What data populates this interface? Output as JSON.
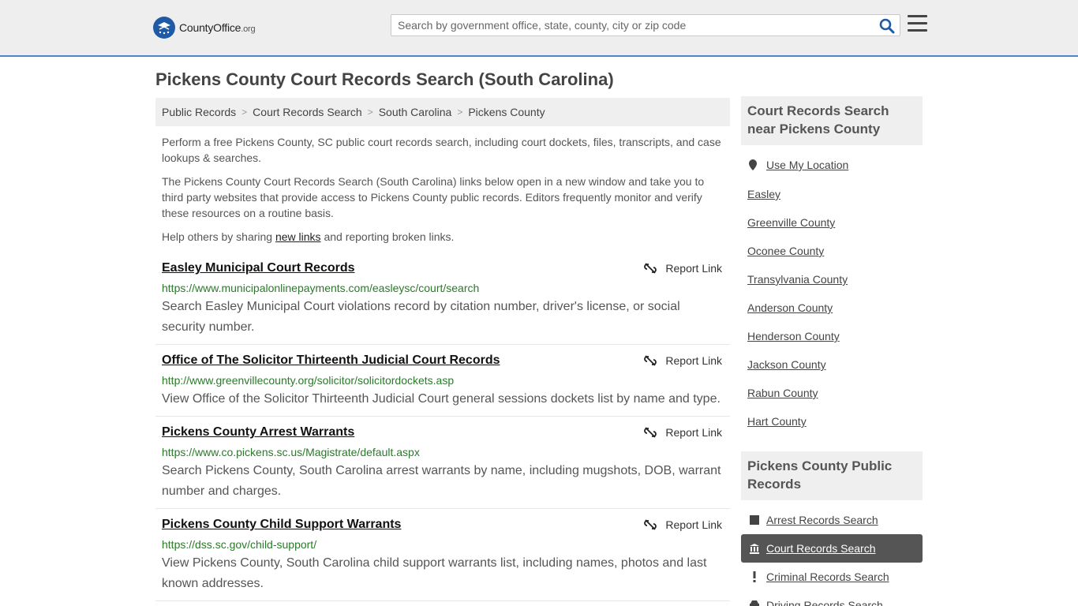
{
  "header": {
    "logo_main": "CountyOffice",
    "logo_org": ".org",
    "search_placeholder": "Search by government office, state, county, city or zip code"
  },
  "page": {
    "title": "Pickens County Court Records Search (South Carolina)"
  },
  "breadcrumb": [
    "Public Records",
    "Court Records Search",
    "South Carolina",
    "Pickens County"
  ],
  "intro": {
    "p1": "Perform a free Pickens County, SC public court records search, including court dockets, files, transcripts, and case lookups & searches.",
    "p2": "The Pickens County Court Records Search (South Carolina) links below open in a new window and take you to third party websites that provide access to Pickens County public records. Editors frequently monitor and verify these resources on a routine basis.",
    "p3_before": "Help others by sharing ",
    "p3_link": "new links",
    "p3_after": " and reporting broken links."
  },
  "report_label": "Report Link",
  "records": [
    {
      "title": "Easley Municipal Court Records",
      "url": "https://www.municipalonlinepayments.com/easleysc/court/search",
      "desc": "Search Easley Municipal Court violations record by citation number, driver's license, or social security number."
    },
    {
      "title": "Office of The Solicitor Thirteenth Judicial Court Records",
      "url": "http://www.greenvillecounty.org/solicitor/solicitordockets.asp",
      "desc": "View Office of the Solicitor Thirteenth Judicial Court general sessions dockets list by name and type."
    },
    {
      "title": "Pickens County Arrest Warrants",
      "url": "https://www.co.pickens.sc.us/Magistrate/default.aspx",
      "desc": "Search Pickens County, South Carolina arrest warrants by name, including mugshots, DOB, warrant number and charges."
    },
    {
      "title": "Pickens County Child Support Warrants",
      "url": "https://dss.sc.gov/child-support/",
      "desc": "View Pickens County, South Carolina child support warrants list, including names, photos and last known addresses."
    }
  ],
  "sidebar": {
    "nearby_heading": "Court Records Search near Pickens County",
    "use_location": "Use My Location",
    "nearby": [
      "Easley",
      "Greenville County",
      "Oconee County",
      "Transylvania County",
      "Anderson County",
      "Henderson County",
      "Jackson County",
      "Rabun County",
      "Hart County"
    ],
    "public_records_heading": "Pickens County Public Records",
    "public_records": [
      {
        "label": "Arrest Records Search",
        "icon": "square-icon"
      },
      {
        "label": "Court Records Search",
        "icon": "courthouse-icon"
      },
      {
        "label": "Criminal Records Search",
        "icon": "exclamation-icon"
      },
      {
        "label": "Driving Records Search",
        "icon": "car-icon"
      }
    ]
  }
}
